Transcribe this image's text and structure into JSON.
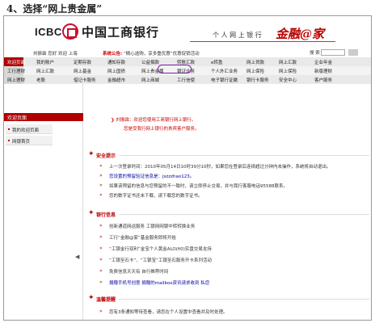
{
  "caption": "4、选择“网上贵金属”",
  "header": {
    "icbc_en": "ICBC",
    "icbc_cn": "中国工商银行",
    "personal": "个 人 网 上 银 行",
    "brand": "金融@家"
  },
  "toolbar": {
    "user": "刘振霖 您好  欢迎  上海",
    "notice_prefix": "系统公告:",
    "notice": "“精心选购，享多重优惠”优惠促销活动",
    "search_label": "搜 索"
  },
  "nav_rows": [
    [
      "欢迎页面",
      "我的账户",
      "定期存款",
      "通知存款",
      "公益捐款",
      "转账汇款",
      "e转盈",
      "网上贷款",
      "网上汇款",
      "企业年金"
    ],
    [
      "工行理财",
      "网上汇款",
      "网上基金",
      "网上国债",
      "网上贵金属",
      "银证业务",
      "个人外汇业务",
      "网上保险",
      "网上保险",
      "新版理财"
    ],
    [
      "网上理财",
      "老股",
      "借记卡服务",
      "金融超市",
      "网上商城",
      "工行信使",
      "电子银行证缴",
      "银行卡服务",
      "安全中心",
      "客户服务"
    ]
  ],
  "sidebar": {
    "header": "欢迎页面",
    "items": [
      "我的欢迎页面",
      "网银首页"
    ]
  },
  "main": {
    "welcome": "刘振霖：欢迎您使用工商银行网上银行。",
    "welcome2": "您是受我行网上银行的贵宾客户服务。",
    "security_title": "安全提示",
    "security_lines": [
      "上一次登录时间：2010年05月14日10时39分10秒，如果您在登录后连续超过分钟内未操作，系统将自动退出。",
      "您设置的预留验证信息是：jszzzhao123。",
      "如果该预留的信息与您预留的不一致时，请立即停止交易，并与我行客服电话95588联系。",
      "您的数字证书还未下载，请下载您的数字证书。"
    ],
    "bank_title": "银行信息",
    "bank_lines": [
      "创新通道网运服务 工银网网银中转转换业务",
      "工行“金融@家”基金服务即将开始",
      "“工银金行双利”金宝个人黄金ALO(ﬁ0)实盘交易支持",
      "“工银至石卡”、“工银宝”工银至石服务开卡系列活动",
      "免费信息天天有 自行推荐时间",
      "捐赠手机号创意 捐赠的mailbox资讯请求收到 私您"
    ],
    "remind_title": "温馨提醒",
    "remind_line": "您有3条通知等待查看，请您在个人设置中查看并及时处理。"
  }
}
